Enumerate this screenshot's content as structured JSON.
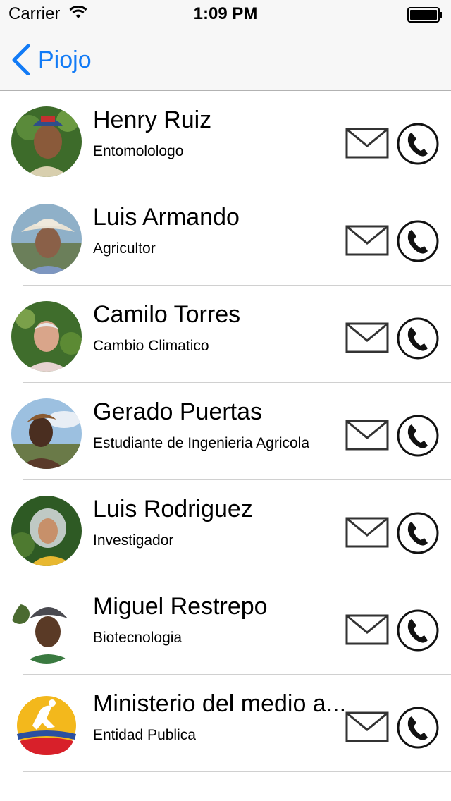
{
  "status": {
    "carrier": "Carrier",
    "time": "1:09 PM"
  },
  "nav": {
    "back_label": "Piojo",
    "tint": "#127bf6"
  },
  "contacts": [
    {
      "name": "Henry Ruiz",
      "role": "Entomolologo"
    },
    {
      "name": "Luis Armando",
      "role": "Agricultor"
    },
    {
      "name": "Camilo Torres",
      "role": "Cambio Climatico"
    },
    {
      "name": "Gerado Puertas",
      "role": "Estudiante de Ingenieria Agricola"
    },
    {
      "name": "Luis Rodriguez",
      "role": "Investigador"
    },
    {
      "name": "Miguel Restrepo",
      "role": "Biotecnologia"
    },
    {
      "name": "Ministerio del medio a...",
      "role": "Entidad Publica"
    }
  ],
  "icons": {
    "mail": "mail-icon",
    "phone": "phone-icon",
    "back": "chevron-left-icon"
  }
}
